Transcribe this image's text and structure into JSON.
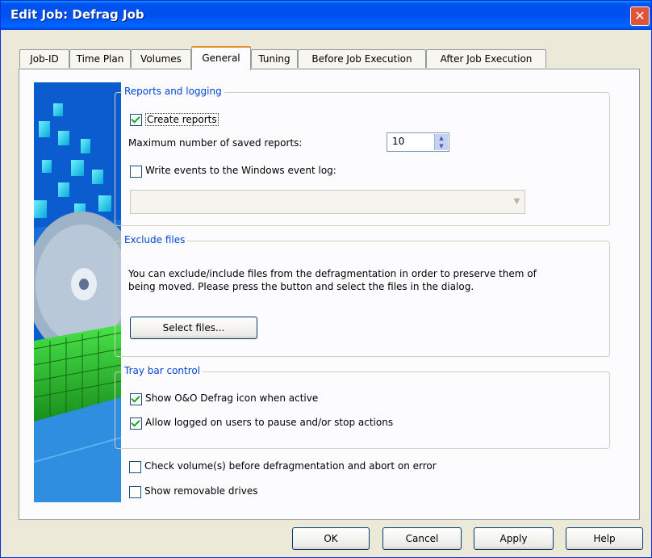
{
  "window": {
    "title": "Edit Job: Defrag Job"
  },
  "tabs": [
    {
      "label": "Job-ID"
    },
    {
      "label": "Time Plan"
    },
    {
      "label": "Volumes"
    },
    {
      "label": "General"
    },
    {
      "label": "Tuning"
    },
    {
      "label": "Before Job Execution"
    },
    {
      "label": "After Job Execution"
    }
  ],
  "active_tab": "General",
  "reports": {
    "title": "Reports and logging",
    "create_reports": {
      "label": "Create reports",
      "checked": true
    },
    "max_saved_label": "Maximum number of saved reports:",
    "max_saved_value": "10",
    "write_events": {
      "label": "Write events to the Windows event log:",
      "checked": false
    },
    "event_log_select_value": ""
  },
  "exclude": {
    "title": "Exclude files",
    "description_line1": "You can exclude/include files from the defragmentation in order to preserve them of",
    "description_line2": "being moved. Please press the button and select the files in the dialog.",
    "select_button": "Select files..."
  },
  "tray": {
    "title": "Tray bar control",
    "show_icon": {
      "label": "Show O&O Defrag icon when active",
      "checked": true
    },
    "allow_users": {
      "label": "Allow logged on users to pause and/or stop actions",
      "checked": true
    }
  },
  "options": {
    "check_volumes": {
      "label": "Check volume(s) before defragmentation and abort on error",
      "checked": false
    },
    "removable": {
      "label": "Show removable drives",
      "checked": false
    }
  },
  "buttons": {
    "ok": "OK",
    "cancel": "Cancel",
    "apply": "Apply",
    "help": "Help"
  },
  "colors": {
    "title_bar": "#0054e3",
    "group_title": "#0046d5",
    "dialog_bg": "#ece9d8",
    "active_tab_accent": "#e68b2c"
  }
}
